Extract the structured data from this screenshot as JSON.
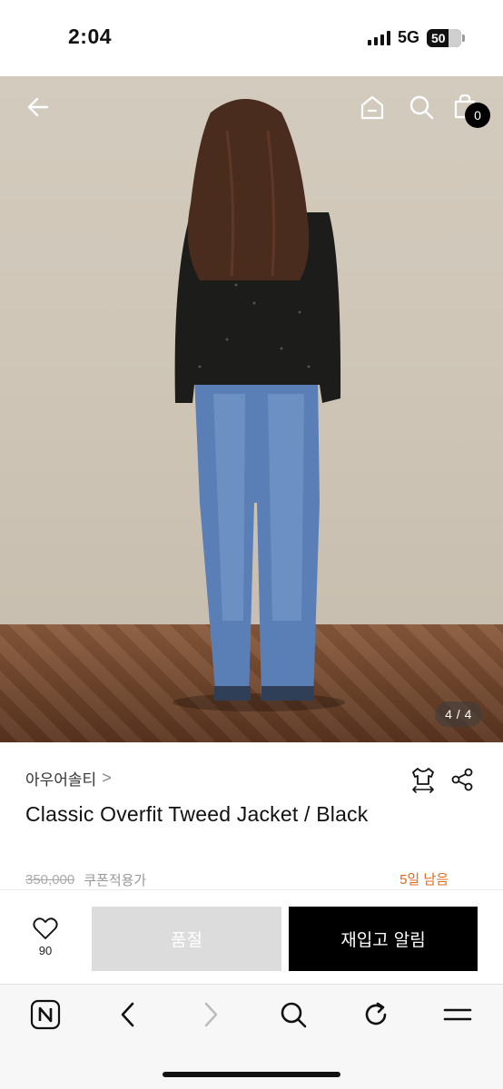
{
  "status_bar": {
    "time": "2:04",
    "network": "5G",
    "battery": "50"
  },
  "header": {
    "back_icon": "arrow-left-icon",
    "home_icon": "home-icon",
    "search_icon": "search-icon",
    "cart_icon": "shopping-bag-icon",
    "cart_count": "0"
  },
  "gallery": {
    "indicator": "4 / 4"
  },
  "product": {
    "brand": "아우어솔티",
    "brand_chevron": ">",
    "title": "Classic Overfit Tweed Jacket / Black",
    "price_original": "350,000",
    "coupon_label": "쿠폰적용가",
    "days_left": "5일 남음",
    "size_icon": "size-guide-shirt-icon",
    "share_icon": "share-icon"
  },
  "actions": {
    "wish_count": "90",
    "soldout_label": "품절",
    "restock_label": "재입고 알림",
    "accent_color": "#e06a1f"
  },
  "browser_toolbar": {
    "items": [
      "naver-home-icon",
      "back-icon",
      "forward-icon",
      "search-icon",
      "refresh-icon",
      "menu-icon"
    ]
  }
}
